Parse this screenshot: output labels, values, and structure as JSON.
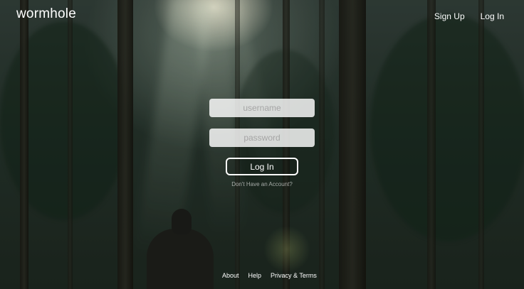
{
  "header": {
    "logo": "wormhole",
    "nav": [
      {
        "label": "Sign Up"
      },
      {
        "label": "Log In"
      }
    ]
  },
  "login_form": {
    "username_placeholder": "username",
    "password_placeholder": "password",
    "submit_label": "Log In",
    "signup_prompt": "Don't Have an Account?"
  },
  "footer": {
    "links": [
      {
        "label": "About"
      },
      {
        "label": "Help"
      },
      {
        "label": "Privacy & Terms"
      }
    ]
  }
}
